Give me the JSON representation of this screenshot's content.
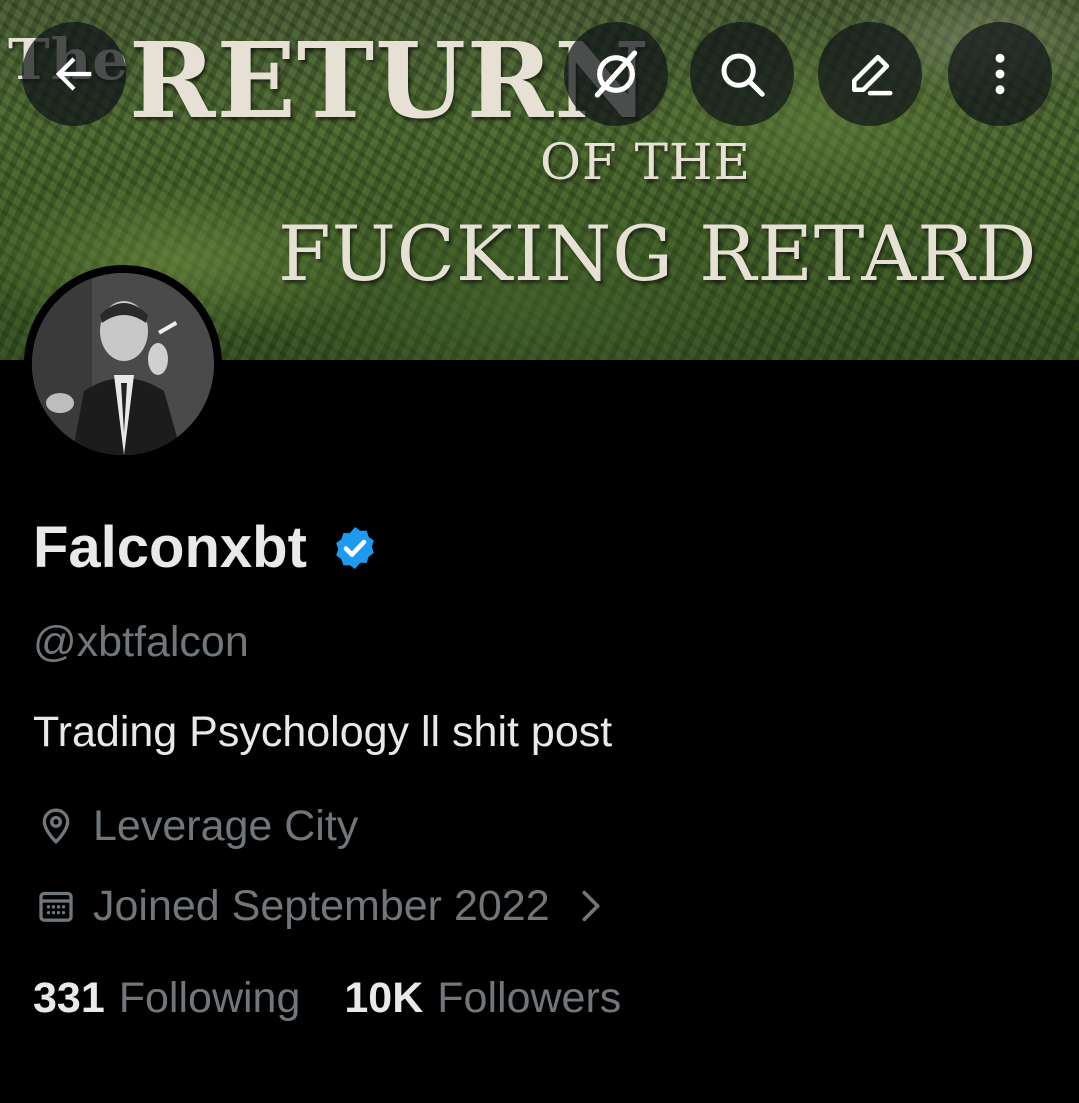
{
  "banner": {
    "line1_prefix": "The",
    "line1_main": "RETURN",
    "line2": "OF THE",
    "line3": "FUCKING RETARD"
  },
  "nav": {
    "back_icon": "arrow-left-icon",
    "grok_icon": "grok-icon",
    "search_icon": "search-icon",
    "edit_icon": "pencil-icon",
    "more_icon": "more-vertical-icon"
  },
  "profile": {
    "display_name": "Falconxbt",
    "verified_color": "#1d9bf0",
    "handle": "@xbtfalcon",
    "bio": "Trading Psychology ll shit post",
    "location": "Leverage City",
    "joined": "Joined September 2022"
  },
  "stats": {
    "following_count": "331",
    "following_label": "Following",
    "followers_count": "10K",
    "followers_label": "Followers"
  },
  "colors": {
    "background": "#000000",
    "primary_text": "#e7e9ea",
    "secondary_text": "#71767b",
    "accent": "#1d9bf0"
  }
}
